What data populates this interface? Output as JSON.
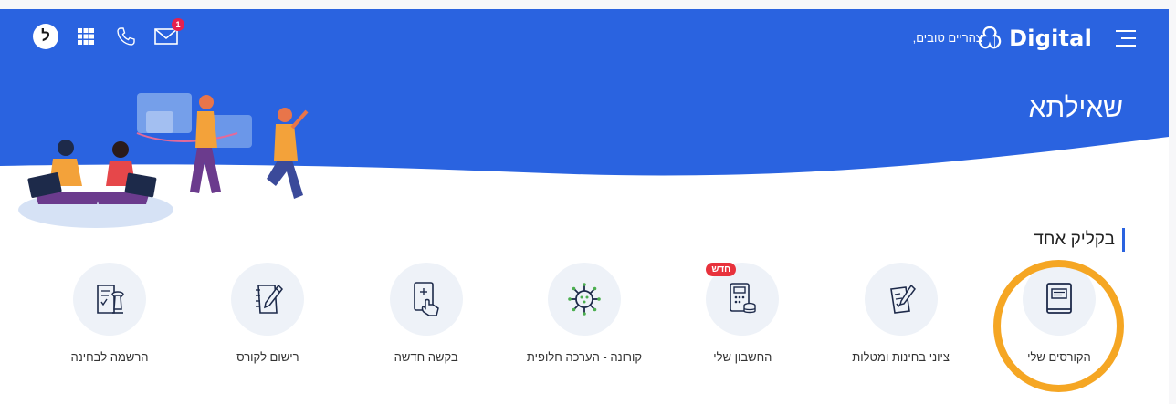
{
  "header": {
    "logo_text": "Digital",
    "greeting": "צהריים טובים,",
    "avatar_letter": "ל",
    "mail_badge": "1",
    "icons": {
      "menu": "hamburger-menu-icon",
      "logo": "digital-logo-icon",
      "apps": "apps-grid-icon",
      "phone": "phone-icon",
      "mail": "mail-icon"
    }
  },
  "page": {
    "title": "שאילתא"
  },
  "section": {
    "title": "בקליק אחד"
  },
  "shortcuts": [
    {
      "label": "הקורסים שלי",
      "icon": "book-icon"
    },
    {
      "label": "ציוני בחינות ומטלות",
      "icon": "grades-icon"
    },
    {
      "label": "החשבון שלי",
      "icon": "account-calculator-icon",
      "badge": "חדש"
    },
    {
      "label": "קורונה - הערכה חלופית",
      "icon": "virus-icon"
    },
    {
      "label": "בקשה חדשה",
      "icon": "tablet-request-icon"
    },
    {
      "label": "רישום לקורס",
      "icon": "notebook-pencil-icon"
    },
    {
      "label": "הרשמה לבחינה",
      "icon": "exam-registration-icon"
    }
  ],
  "colors": {
    "brand_blue": "#2a63e0",
    "badge_red": "#e8323c",
    "highlight": "#f5a623",
    "circle_bg": "#eef2f8"
  }
}
